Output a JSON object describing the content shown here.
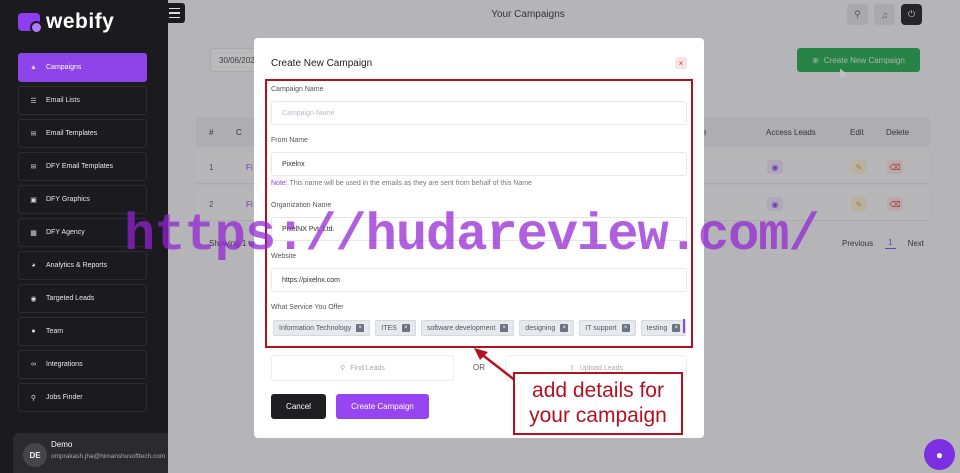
{
  "app": {
    "logo_text": "webify"
  },
  "sidebar": {
    "items": [
      {
        "label": "Campaigns",
        "icon": "megaphone-icon",
        "active": true
      },
      {
        "label": "Email Lists",
        "icon": "list-icon"
      },
      {
        "label": "Email Templates",
        "icon": "envelope-icon"
      },
      {
        "label": "DFY Email Templates",
        "icon": "envelope-icon"
      },
      {
        "label": "DFY Graphics",
        "icon": "image-icon"
      },
      {
        "label": "DFY Agency",
        "icon": "building-icon"
      },
      {
        "label": "Analytics & Reports",
        "icon": "analytics-icon"
      },
      {
        "label": "Targeted Leads",
        "icon": "target-icon"
      },
      {
        "label": "Team",
        "icon": "team-icon"
      },
      {
        "label": "Integrations",
        "icon": "integrations-icon"
      },
      {
        "label": "Jobs Finder",
        "icon": "search-icon"
      }
    ],
    "profile": {
      "initials": "DE",
      "name": "Demo",
      "email": "omprakash.jha@himanshusofttech.com"
    }
  },
  "topbar": {
    "title": "Your Campaigns"
  },
  "background": {
    "date_value": "30/06/202",
    "create_button": "Create New Campaign",
    "table": {
      "headers": [
        "#",
        "C",
        "e",
        "Access Leads",
        "Edit",
        "Delete"
      ],
      "rows": [
        {
          "num": "1",
          "name": "Fi"
        },
        {
          "num": "2",
          "name": "Fi"
        }
      ]
    },
    "showing": "Showing 1 to",
    "pager": {
      "prev": "Previous",
      "current": "1",
      "next": "Next"
    }
  },
  "modal": {
    "title": "Create New Campaign",
    "campaign_name": {
      "label": "Campaign Name",
      "placeholder": "Campaign Name",
      "value": ""
    },
    "from_name": {
      "label": "From Name",
      "value": "Pixelnx"
    },
    "note": {
      "prefix": "Note:",
      "text": " This name will be used in the emails as they are sent from behalf of this Name"
    },
    "organization": {
      "label": "Organization Name",
      "value": "PixelNX Pvt. Ltd."
    },
    "website": {
      "label": "Website",
      "value": "https://pixelnx.com"
    },
    "services": {
      "label": "What Service You Offer",
      "tags": [
        "Information Technology",
        "ITES",
        "software development",
        "designing",
        "IT support",
        "testing"
      ]
    },
    "find_leads": "Find Leads",
    "or": "OR",
    "upload_leads": "Upload Leads",
    "cancel": "Cancel",
    "submit": "Create Campaign"
  },
  "annotation": {
    "line1": "add details for",
    "line2": "your campaign"
  },
  "watermark": "https://hudareview.com/",
  "colors": {
    "accent": "#8d44e9",
    "success": "#1fa64a",
    "annotation": "#b5101f"
  }
}
